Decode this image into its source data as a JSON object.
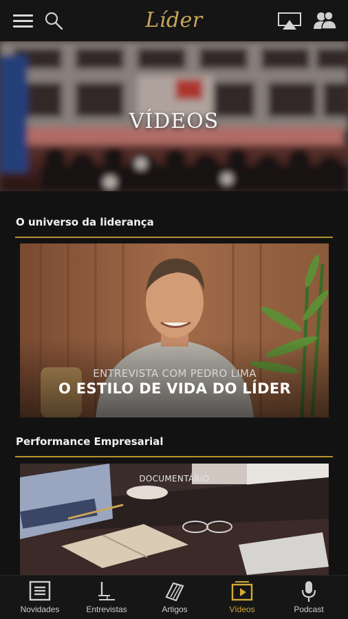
{
  "app": {
    "logo_text": "Líder",
    "accent_color": "#c9a75a",
    "icons": [
      "menu-icon",
      "search-icon",
      "airplay-icon",
      "users-icon"
    ]
  },
  "hero": {
    "title": "VÍDEOS"
  },
  "sections": [
    {
      "title": "O universo da liderança",
      "video": {
        "subtitle": "ENTREVISTA COM PEDRO LIMA",
        "title": "O ESTILO DE VIDA DO LÍDER"
      }
    },
    {
      "title": "Performance Empresarial",
      "video": {
        "subtitle": "DOCUMENTÁRIO"
      }
    }
  ],
  "bottom_nav": {
    "active": "Vídeos",
    "active_color": "#d4a937",
    "items": [
      {
        "label": "Novidades",
        "icon": "news-icon"
      },
      {
        "label": "Entrevistas",
        "icon": "interview-icon"
      },
      {
        "label": "Artigos",
        "icon": "articles-icon"
      },
      {
        "label": "Vídeos",
        "icon": "video-icon"
      },
      {
        "label": "Podcast",
        "icon": "microphone-icon"
      }
    ]
  }
}
